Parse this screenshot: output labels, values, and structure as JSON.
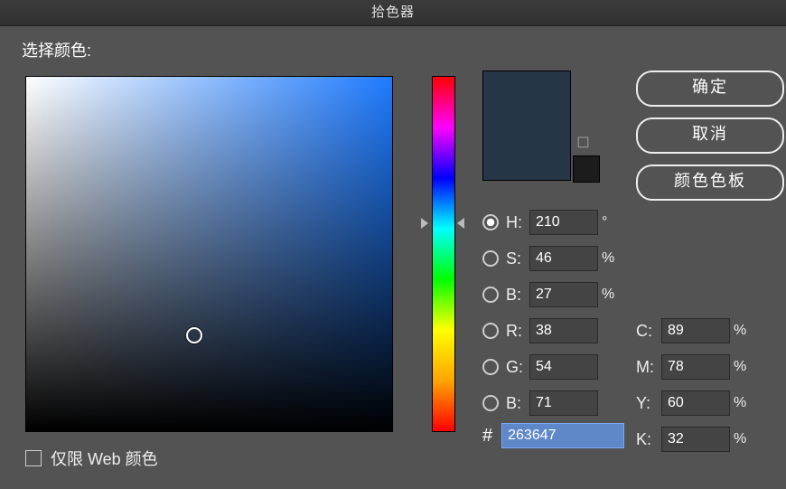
{
  "window_title": "拾色器",
  "labels": {
    "select_color": "选择颜色:",
    "web_only": "仅限 Web 颜色"
  },
  "buttons": {
    "ok": "确定",
    "cancel": "取消",
    "swatches": "颜色色板"
  },
  "preview": {
    "new_hex": "#263647",
    "old_hex": "#1c1c1c"
  },
  "hsb": {
    "h": {
      "label": "H:",
      "value": "210",
      "unit": "°",
      "selected": true
    },
    "s": {
      "label": "S:",
      "value": "46",
      "unit": "%",
      "selected": false
    },
    "b": {
      "label": "B:",
      "value": "27",
      "unit": "%",
      "selected": false
    }
  },
  "rgb": {
    "r": {
      "label": "R:",
      "value": "38",
      "selected": false
    },
    "g": {
      "label": "G:",
      "value": "54",
      "selected": false
    },
    "b": {
      "label": "B:",
      "value": "71",
      "selected": false
    }
  },
  "cmyk": {
    "c": {
      "label": "C:",
      "value": "89",
      "unit": "%"
    },
    "m": {
      "label": "M:",
      "value": "78",
      "unit": "%"
    },
    "y": {
      "label": "Y:",
      "value": "60",
      "unit": "%"
    },
    "k": {
      "label": "K:",
      "value": "32",
      "unit": "%"
    }
  },
  "hex": {
    "label": "#",
    "value": "263647"
  },
  "sv_cursor": {
    "x_pct": 46,
    "y_pct": 73
  },
  "hue_thumb_pct": 41.6
}
